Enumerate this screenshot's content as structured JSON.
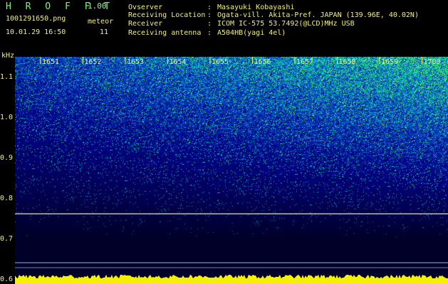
{
  "header": {
    "app_name": "H R O F F T",
    "version": "1.00",
    "filename": "1001291650.png",
    "mode": "meteor",
    "datetime": "10.01.29 16:50",
    "count": "11",
    "fields": [
      {
        "label": "Ovserver",
        "value": "Masayuki Kobayashi"
      },
      {
        "label": "Receiving Location",
        "value": "Ogata-vill. Akita-Pref. JAPAN (139.96E, 40.02N)"
      },
      {
        "label": "Receiver",
        "value": "ICOM IC-575 53.7492(@LCD)MHz USB"
      },
      {
        "label": "Receiving antenna",
        "value": "A504HB(yagi 4el)"
      }
    ]
  },
  "spectrogram": {
    "y_unit": "kHz",
    "y_ticks": [
      "1.1",
      "1.0",
      "0.9",
      "0.8",
      "0.7",
      "0.6"
    ],
    "y_range": [
      0.59,
      1.15
    ],
    "time_labels": [
      "1651",
      "1652",
      "1653",
      "1654",
      "1655",
      "1656",
      "1657",
      "1658",
      "1659",
      "1700"
    ],
    "signal_line_khz": 0.763,
    "colors": {
      "text": "#f5f07a",
      "signal_line": "#e8e88c",
      "baseline": "#f5f000",
      "low_line": "#8fb0d8"
    }
  }
}
